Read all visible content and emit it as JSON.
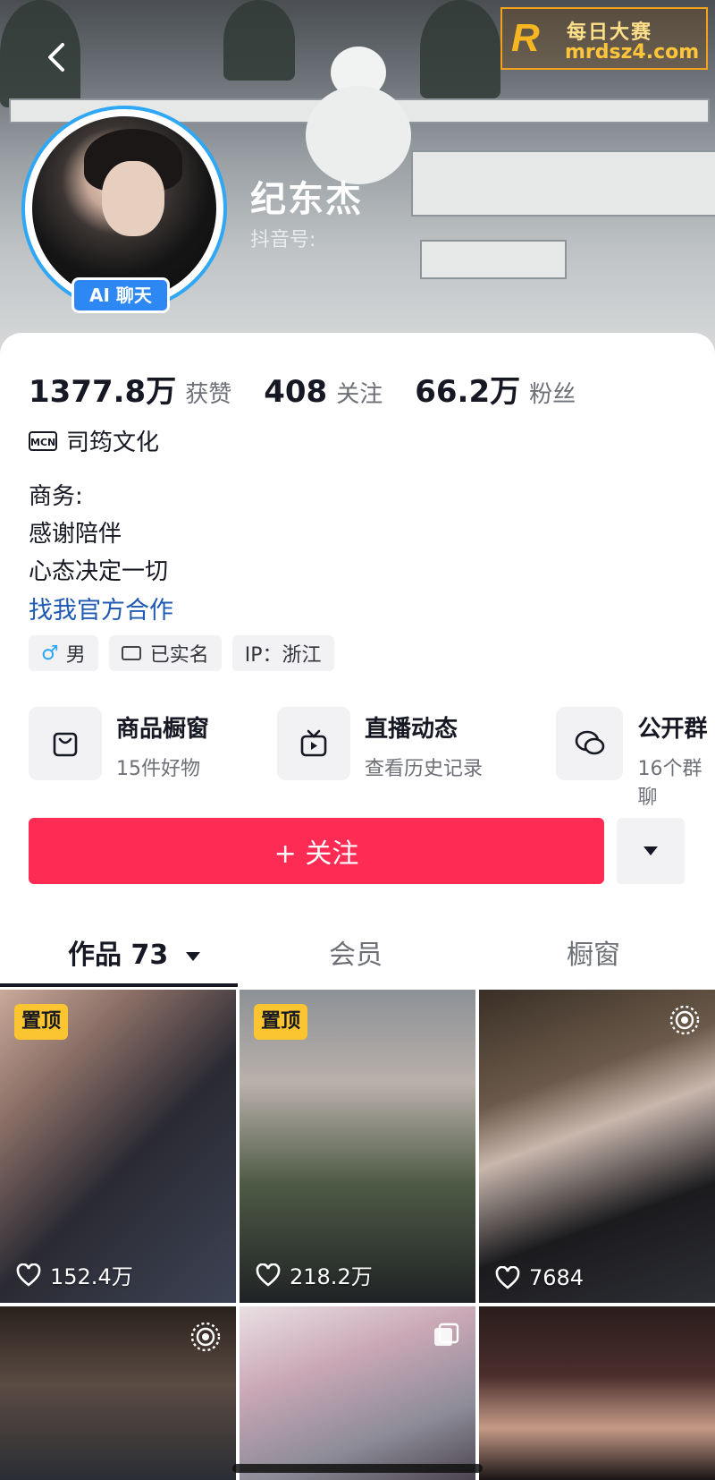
{
  "header": {
    "back_icon": "chevron-left-icon",
    "watermark": {
      "logo_letter": "R",
      "line1": "每日大赛",
      "line2": "mrdsz4.com"
    },
    "ai_badge": "AI 聊天",
    "name": "纪东杰",
    "douyin_id_label": "抖音号:"
  },
  "stats": [
    {
      "value": "1377.8万",
      "label": "获赞"
    },
    {
      "value": "408",
      "label": "关注"
    },
    {
      "value": "66.2万",
      "label": "粉丝"
    }
  ],
  "mcn": {
    "icon_text": "MCN",
    "org": "司筠文化"
  },
  "bio": {
    "lines": [
      "商务:",
      "感谢陪伴",
      "心态决定一切"
    ],
    "link": "找我官方合作"
  },
  "tags": [
    {
      "icon": "male-icon",
      "glyph": "♂",
      "label": "男"
    },
    {
      "icon": "id-card-icon",
      "label": "已实名"
    },
    {
      "label": "IP：浙江"
    }
  ],
  "shortcuts": [
    {
      "icon": "shopping-bag-icon",
      "title": "商品橱窗",
      "subtitle": "15件好物"
    },
    {
      "icon": "tv-icon",
      "title": "直播动态",
      "subtitle": "查看历史记录"
    },
    {
      "icon": "chat-bubbles-icon",
      "title": "公开群",
      "subtitle": "16个群聊"
    }
  ],
  "follow_button": "+ 关注",
  "more_icon": "caret-down-icon",
  "tabs": [
    {
      "label": "作品 73",
      "active": true
    },
    {
      "label": "会员",
      "active": false
    },
    {
      "label": "橱窗",
      "active": false
    }
  ],
  "videos": [
    {
      "pinned_label": "置顶",
      "likes": "152.4万"
    },
    {
      "pinned_label": "置顶",
      "likes": "218.2万"
    },
    {
      "likes": "7684",
      "corner_icon": "live-icon"
    },
    {
      "corner_icon": "live-icon"
    },
    {
      "corner_icon": "multi-image-icon"
    },
    {}
  ],
  "colors": {
    "primary": "#fe2c55",
    "link": "#1f5ab3",
    "ai_badge": "#2d88f3",
    "pin": "#fac530"
  }
}
